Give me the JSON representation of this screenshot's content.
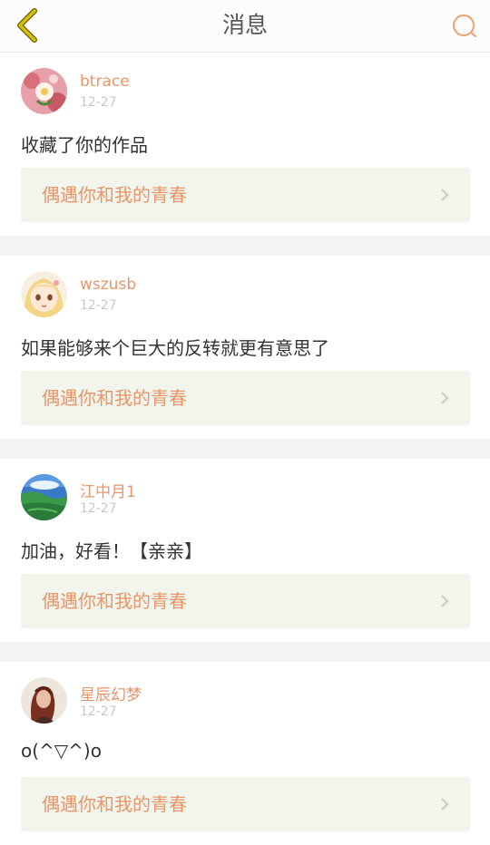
{
  "header": {
    "title": "消息"
  },
  "messages": [
    {
      "username": "btrace",
      "date": "12-27",
      "text": "收藏了你的作品",
      "work_title": "偶遇你和我的青春"
    },
    {
      "username": "wszusb",
      "date": "12-27",
      "text": "如果能够来个巨大的反转就更有意思了",
      "work_title": "偶遇你和我的青春"
    },
    {
      "username": "江中月1",
      "date": "12-27",
      "text": "加油，好看！【亲亲】",
      "work_title": "偶遇你和我的青春"
    },
    {
      "username": "星辰幻梦",
      "date": "12-27",
      "text": "o(^▽^)o",
      "work_title": "偶遇你和我的青春"
    }
  ],
  "colors": {
    "accent": "#e8956a",
    "back_arrow": "#c8b000",
    "link_bg": "#f1f5eb"
  }
}
